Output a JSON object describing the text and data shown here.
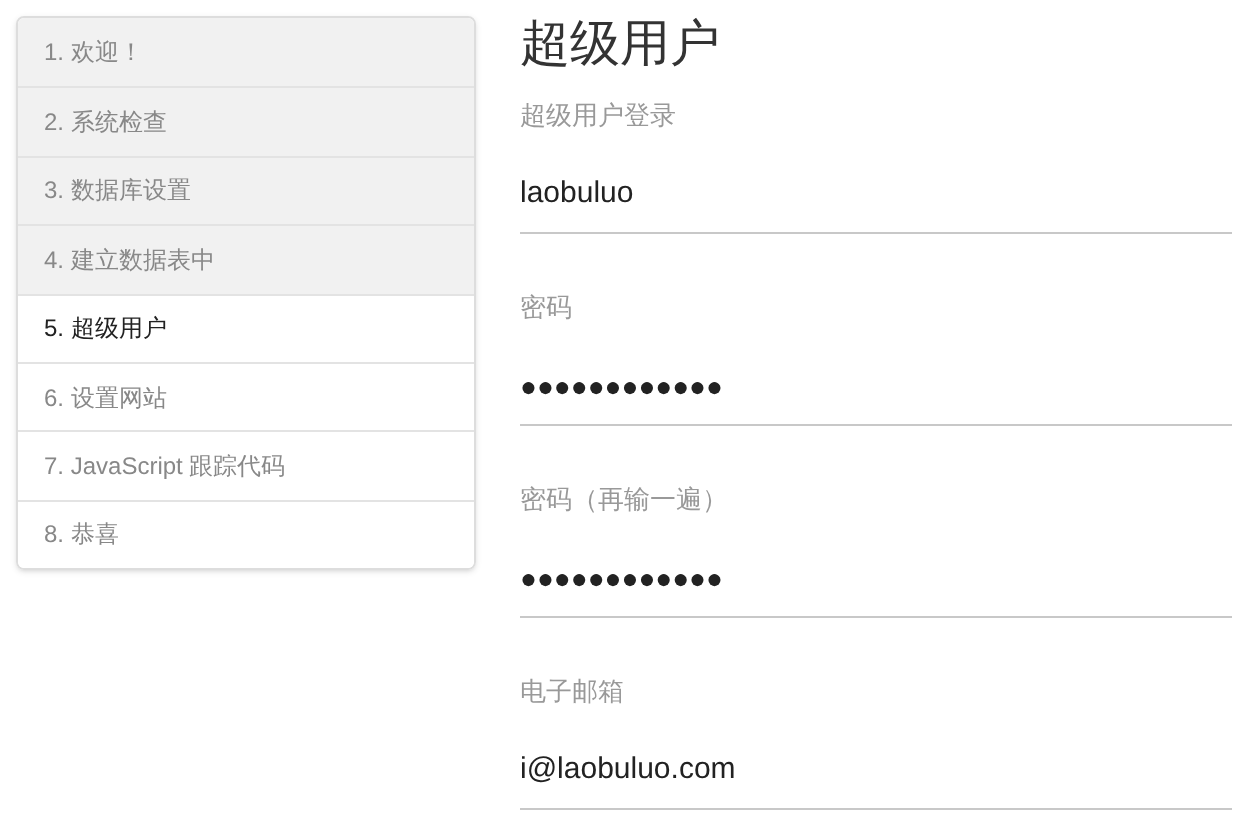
{
  "steps": [
    {
      "label": "1. 欢迎！",
      "done": true,
      "selected": false
    },
    {
      "label": "2. 系统检查",
      "done": true,
      "selected": false
    },
    {
      "label": "3. 数据库设置",
      "done": true,
      "selected": false
    },
    {
      "label": "4. 建立数据表中",
      "done": true,
      "selected": false
    },
    {
      "label": "5. 超级用户",
      "done": false,
      "selected": true
    },
    {
      "label": "6. 设置网站",
      "done": false,
      "selected": false
    },
    {
      "label": "7. JavaScript 跟踪代码",
      "done": false,
      "selected": false
    },
    {
      "label": "8. 恭喜",
      "done": false,
      "selected": false
    }
  ],
  "heading": "超级用户",
  "fields": [
    {
      "label": "超级用户登录",
      "value": "laobuluo",
      "kind": "text"
    },
    {
      "label": "密码",
      "value": "●●●●●●●●●●●●",
      "kind": "password"
    },
    {
      "label": "密码（再输一遍）",
      "value": "●●●●●●●●●●●●",
      "kind": "password"
    },
    {
      "label": "电子邮箱",
      "value": "i@laobuluo.com",
      "kind": "text"
    }
  ]
}
